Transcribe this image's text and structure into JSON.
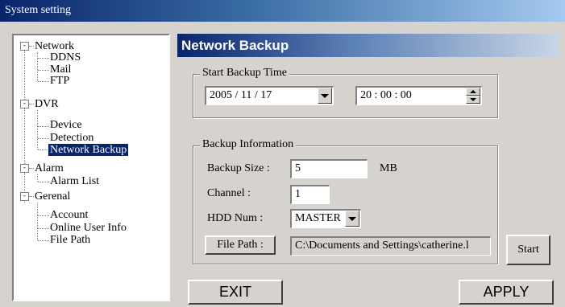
{
  "window": {
    "title": "System setting"
  },
  "tree": {
    "network": {
      "label": "Network",
      "children": [
        "DDNS",
        "Mail",
        "FTP"
      ]
    },
    "dvr": {
      "label": "DVR",
      "children": [
        "Device",
        "Detection",
        "Network Backup"
      ]
    },
    "alarm": {
      "label": "Alarm",
      "children": [
        "Alarm List"
      ]
    },
    "general": {
      "label": "Gerenal",
      "children": [
        "Account",
        "Online User Info",
        "File Path"
      ]
    },
    "expander_symbol": "-"
  },
  "panel": {
    "title": "Network Backup",
    "start_backup": {
      "group_label": "Start Backup Time",
      "date": "2005 / 11 / 17",
      "time": "20 : 00 : 00"
    },
    "backup_info": {
      "group_label": "Backup Information",
      "size_label": "Backup Size :",
      "size_value": "5",
      "size_unit": "MB",
      "channel_label": "Channel :",
      "channel_value": "1",
      "hdd_label": "HDD Num :",
      "hdd_value": "MASTER",
      "file_path_button": "File Path :",
      "file_path_value": "C:\\Documents and Settings\\catherine.l"
    },
    "start_button": "Start",
    "exit_button": "EXIT",
    "apply_button": "APPLY"
  },
  "colors": {
    "title_bar": "#0a246a",
    "selection": "#0a246a",
    "face": "#d6d3ce"
  }
}
